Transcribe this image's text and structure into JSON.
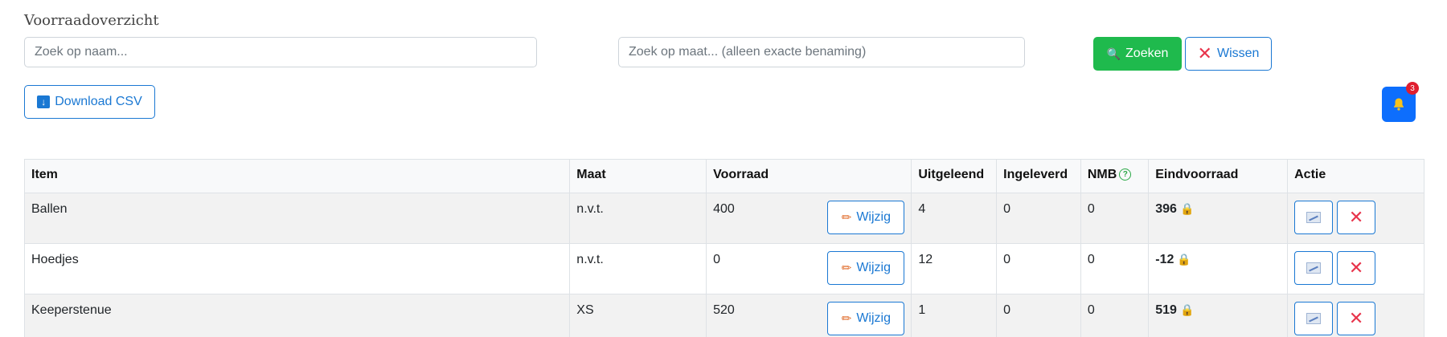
{
  "page": {
    "title": "Voorraadoverzicht"
  },
  "search": {
    "name_placeholder": "Zoek op naam...",
    "size_placeholder": "Zoek op maat... (alleen exacte benaming)",
    "search_label": "Zoeken",
    "clear_label": "Wissen"
  },
  "toolbar": {
    "csv_label": "Download CSV",
    "notification_count": "3"
  },
  "table": {
    "headers": {
      "item": "Item",
      "maat": "Maat",
      "voorraad": "Voorraad",
      "uitgeleend": "Uitgeleend",
      "ingeleverd": "Ingeleverd",
      "nmb": "NMB",
      "eindvoorraad": "Eindvoorraad",
      "actie": "Actie"
    },
    "edit_label": "Wijzig",
    "rows": [
      {
        "item": "Ballen",
        "maat": "n.v.t.",
        "voorraad": "400",
        "uitgeleend": "4",
        "ingeleverd": "0",
        "nmb": "0",
        "eindvoorraad": "396"
      },
      {
        "item": "Hoedjes",
        "maat": "n.v.t.",
        "voorraad": "0",
        "uitgeleend": "12",
        "ingeleverd": "0",
        "nmb": "0",
        "eindvoorraad": "-12"
      },
      {
        "item": "Keeperstenue",
        "maat": "XS",
        "voorraad": "520",
        "uitgeleend": "1",
        "ingeleverd": "0",
        "nmb": "0",
        "eindvoorraad": "519"
      }
    ]
  },
  "icons": {
    "search": "magnifier-icon",
    "clear": "close-icon",
    "download": "download-icon",
    "bell": "bell-icon",
    "help": "help-circle-icon",
    "edit": "pencil-icon",
    "lock": "lock-icon",
    "chart": "chart-icon",
    "delete": "close-icon"
  },
  "colors": {
    "primary": "#1a78d3",
    "success": "#1fba4d",
    "danger": "#e8344b",
    "bell_bg": "#0d6efd",
    "bell_icon": "#f7c21b",
    "badge": "#e01e2f",
    "stripe": "#f2f2f2"
  }
}
